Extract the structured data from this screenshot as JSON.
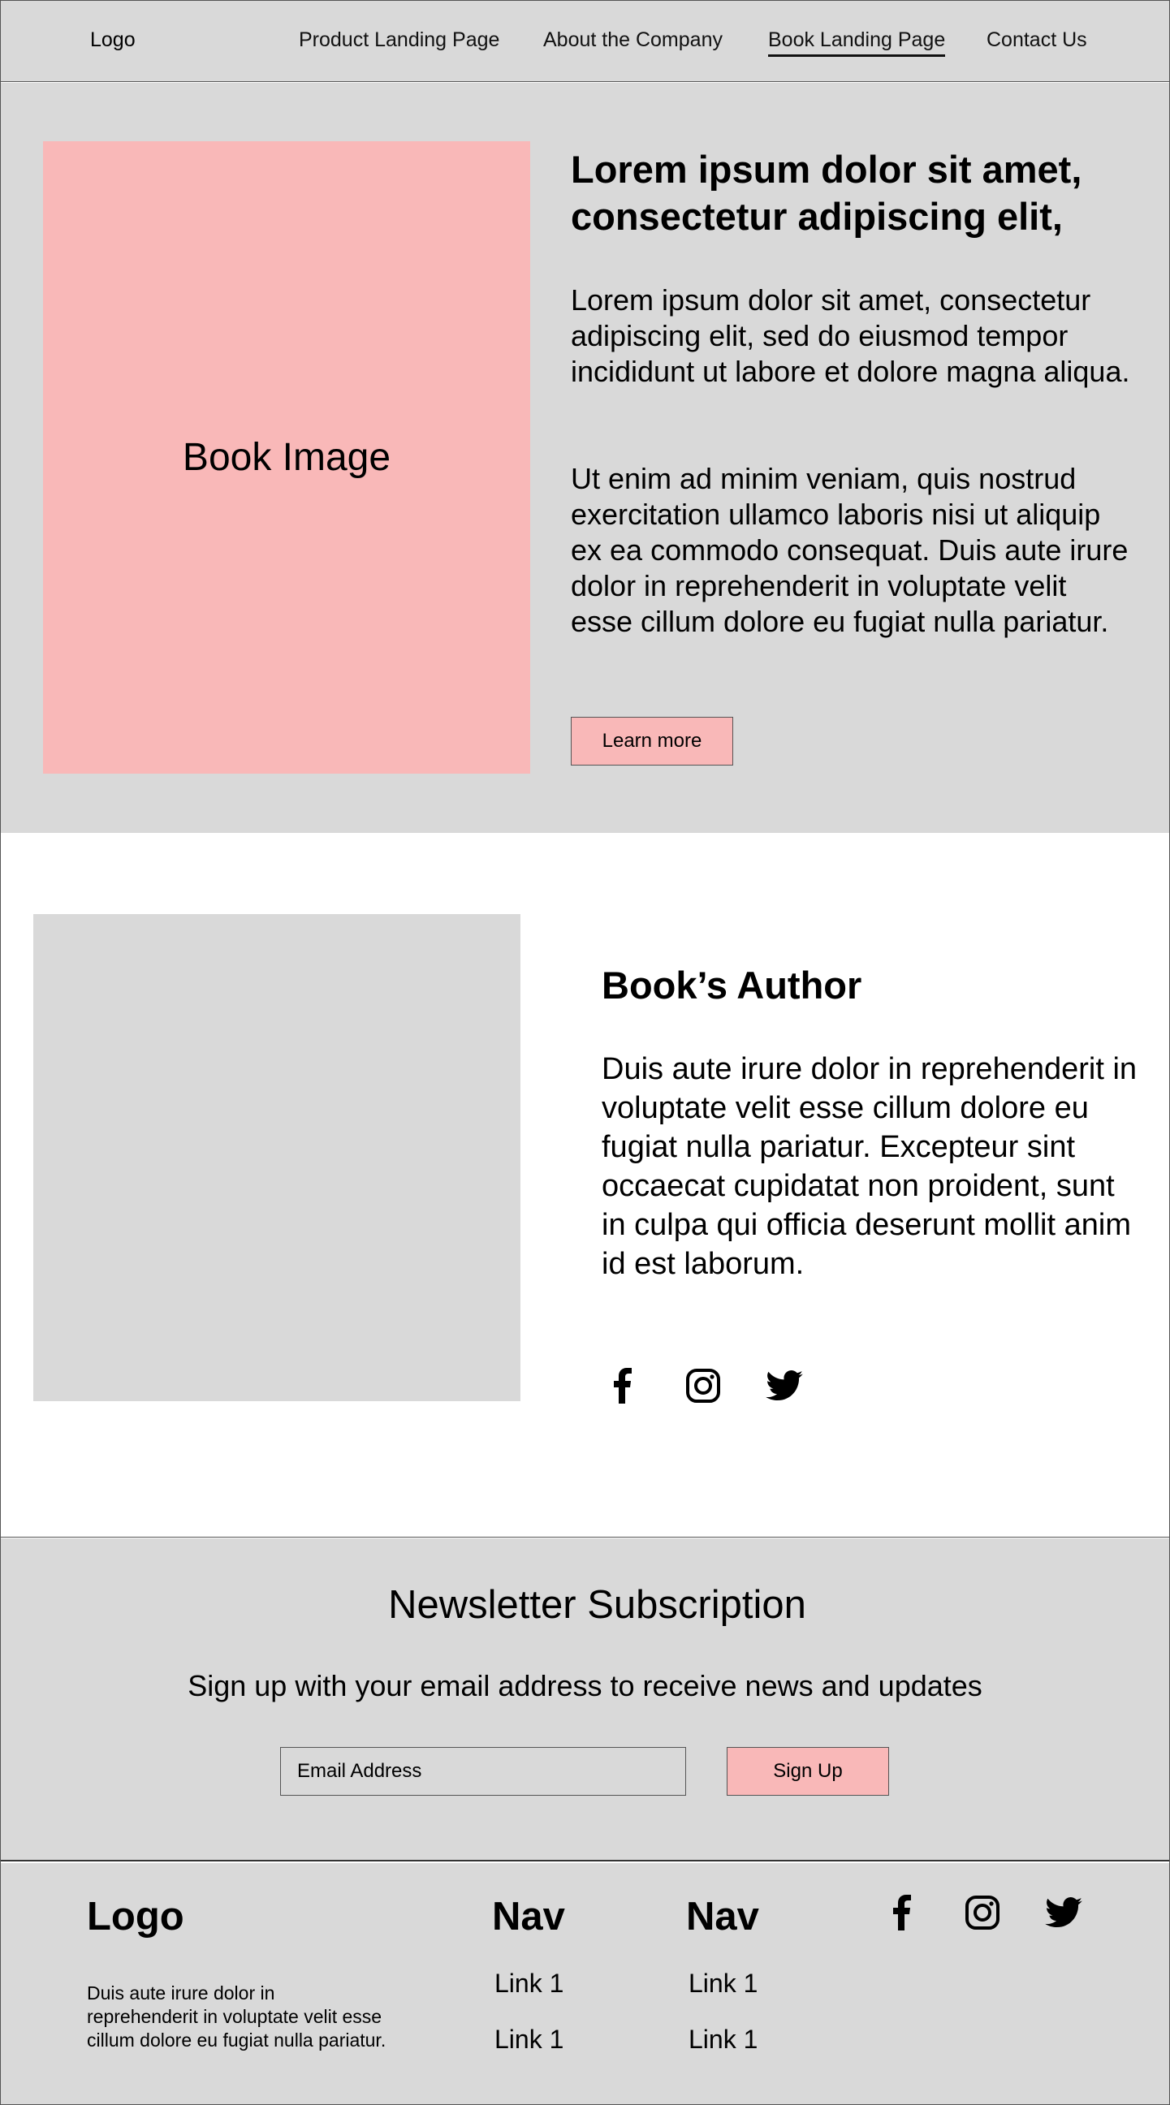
{
  "header": {
    "logo": "Logo",
    "nav": [
      "Product Landing Page",
      "About the Company",
      "Book Landing Page",
      "Contact Us"
    ],
    "active": "Book Landing Page"
  },
  "hero": {
    "image_label": "Book Image",
    "title": "Lorem ipsum dolor sit amet, consectetur adipiscing elit,",
    "paragraph1": "Lorem ipsum dolor sit amet, consectetur adipiscing elit, sed do eiusmod tempor incididunt ut labore et dolore magna aliqua.",
    "paragraph2": "Ut enim ad minim veniam, quis nostrud exercitation ullamco laboris nisi ut aliquip ex ea commodo consequat. Duis aute irure dolor in reprehenderit in voluptate velit esse cillum dolore eu fugiat nulla pariatur.",
    "button": "Learn more"
  },
  "author": {
    "title": "Book’s Author",
    "paragraph": "Duis aute irure dolor in reprehenderit in voluptate velit esse cillum dolore eu fugiat nulla pariatur. Excepteur sint occaecat cupidatat non proident, sunt in culpa qui officia deserunt mollit anim id est laborum.",
    "social_icons": [
      "facebook-icon",
      "instagram-icon",
      "twitter-icon"
    ]
  },
  "newsletter": {
    "title": "Newsletter Subscription",
    "subtitle": "Sign up with your email address to receive news and updates",
    "email_placeholder": "Email Address",
    "button": "Sign Up"
  },
  "footer": {
    "logo": "Logo",
    "description": "Duis aute irure dolor in reprehenderit in voluptate velit esse cillum dolore eu fugiat nulla pariatur.",
    "nav_columns": [
      {
        "title": "Nav",
        "links": [
          "Link 1",
          "Link 1"
        ]
      },
      {
        "title": "Nav",
        "links": [
          "Link 1",
          "Link 1"
        ]
      }
    ],
    "social_icons": [
      "facebook-icon",
      "instagram-icon",
      "twitter-icon"
    ]
  },
  "colors": {
    "panel_gray": "#d9d9d9",
    "accent_pink": "#f9b8b8",
    "border": "#555555"
  }
}
